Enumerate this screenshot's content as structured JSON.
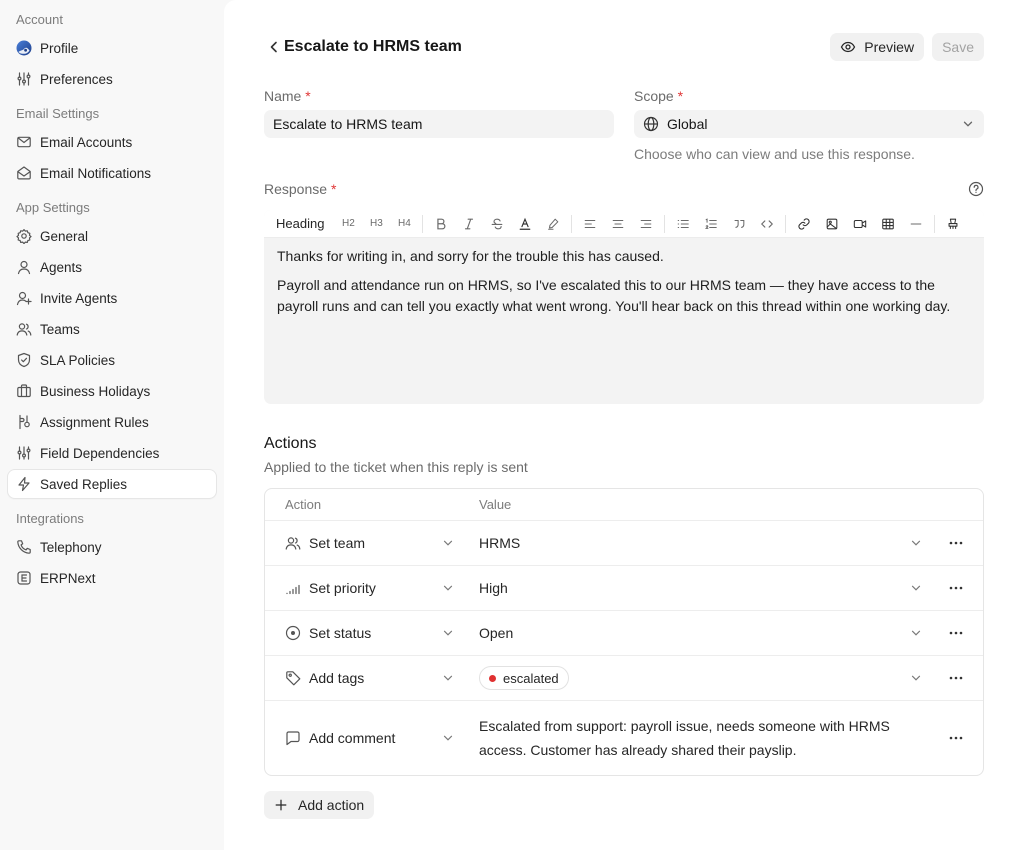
{
  "sidebar": {
    "sections": [
      {
        "title": "Account",
        "items": [
          {
            "name": "profile",
            "label": "Profile",
            "icon": "avatar-icon",
            "active": false
          },
          {
            "name": "preferences",
            "label": "Preferences",
            "icon": "sliders-icon",
            "active": false
          }
        ]
      },
      {
        "title": "Email Settings",
        "items": [
          {
            "name": "email-accounts",
            "label": "Email Accounts",
            "icon": "mail-icon",
            "active": false
          },
          {
            "name": "email-notifications",
            "label": "Email Notifications",
            "icon": "mail-open-icon",
            "active": false
          }
        ]
      },
      {
        "title": "App Settings",
        "items": [
          {
            "name": "general",
            "label": "General",
            "icon": "gear-icon",
            "active": false
          },
          {
            "name": "agents",
            "label": "Agents",
            "icon": "user-icon",
            "active": false
          },
          {
            "name": "invite-agents",
            "label": "Invite Agents",
            "icon": "user-plus-icon",
            "active": false
          },
          {
            "name": "teams",
            "label": "Teams",
            "icon": "users-icon",
            "active": false
          },
          {
            "name": "sla-policies",
            "label": "SLA Policies",
            "icon": "shield-check-icon",
            "active": false
          },
          {
            "name": "business-holidays",
            "label": "Business Holidays",
            "icon": "briefcase-icon",
            "active": false
          },
          {
            "name": "assignment-rules",
            "label": "Assignment Rules",
            "icon": "assignment-icon",
            "active": false
          },
          {
            "name": "field-dependencies",
            "label": "Field Dependencies",
            "icon": "sliders-icon",
            "active": false
          },
          {
            "name": "saved-replies",
            "label": "Saved Replies",
            "icon": "lightning-icon",
            "active": true
          }
        ]
      },
      {
        "title": "Integrations",
        "items": [
          {
            "name": "telephony",
            "label": "Telephony",
            "icon": "phone-icon",
            "active": false
          },
          {
            "name": "erpnext",
            "label": "ERPNext",
            "icon": "erpnext-icon",
            "active": false
          }
        ]
      }
    ]
  },
  "header": {
    "title": "Escalate to HRMS team",
    "preview_label": "Preview",
    "save_label": "Save"
  },
  "form": {
    "name_label": "Name",
    "name_value": "Escalate to HRMS team",
    "scope_label": "Scope",
    "scope_value": "Global",
    "scope_hint": "Choose who can view and use this response.",
    "response_label": "Response",
    "required_mark": "*"
  },
  "editor": {
    "heading_label": "Heading",
    "heading_buttons": [
      "H2",
      "H3",
      "H4"
    ],
    "paragraphs": [
      "Thanks for writing in, and sorry for the trouble this has caused.",
      "Payroll and attendance run on HRMS, so I've escalated this to our HRMS team — they have access to the payroll runs and can tell you exactly what went wrong. You'll hear back on this thread within one working day."
    ]
  },
  "actions": {
    "title": "Actions",
    "subtitle": "Applied to the ticket when this reply is sent",
    "col_action": "Action",
    "col_value": "Value",
    "rows": [
      {
        "name": "set-team",
        "action": "Set team",
        "icon": "users-icon",
        "value": "HRMS",
        "kind": "select"
      },
      {
        "name": "set-priority",
        "action": "Set priority",
        "icon": "signal-bars-icon",
        "value": "High",
        "kind": "select"
      },
      {
        "name": "set-status",
        "action": "Set status",
        "icon": "circle-dot-icon",
        "value": "Open",
        "kind": "select"
      },
      {
        "name": "add-tags",
        "action": "Add tags",
        "icon": "tag-icon",
        "value": "escalated",
        "kind": "tag",
        "tag_color": "#e03131"
      },
      {
        "name": "add-comment",
        "action": "Add comment",
        "icon": "comment-icon",
        "value": "Escalated from support: payroll issue, needs someone with HRMS access. Customer has already shared their payslip.",
        "kind": "text"
      }
    ],
    "add_action_label": "Add action"
  }
}
